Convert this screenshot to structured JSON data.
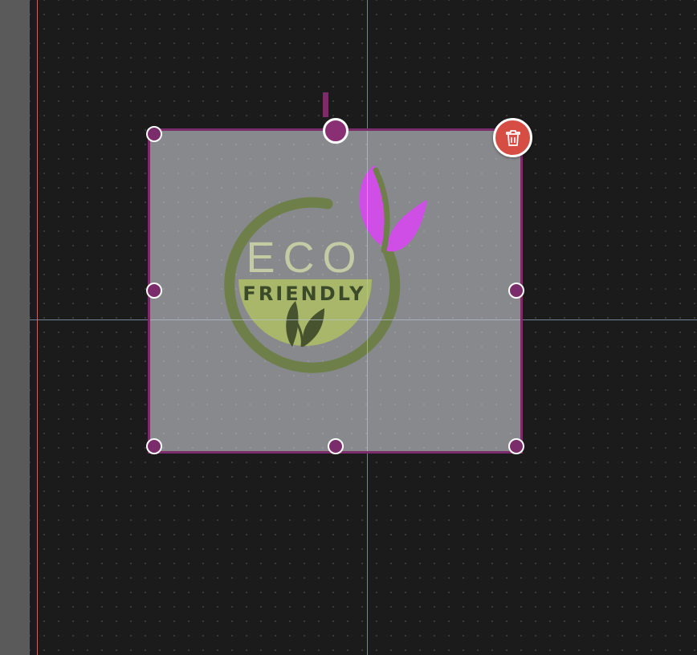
{
  "logo": {
    "word_top": "ECO",
    "word_bottom": "FRIENDLY"
  },
  "colors": {
    "selection": "#7a2d6a",
    "delete": "#d64d44",
    "logo_dark_green": "#6e7f49",
    "logo_light_green": "#a8b76a",
    "logo_pale_text": "#c3caa4",
    "leaf_magenta": "#cf4ee6",
    "guide": "#7b8fa6"
  },
  "icons": {
    "delete": "trash-icon",
    "rotate": "rotate-handle"
  }
}
